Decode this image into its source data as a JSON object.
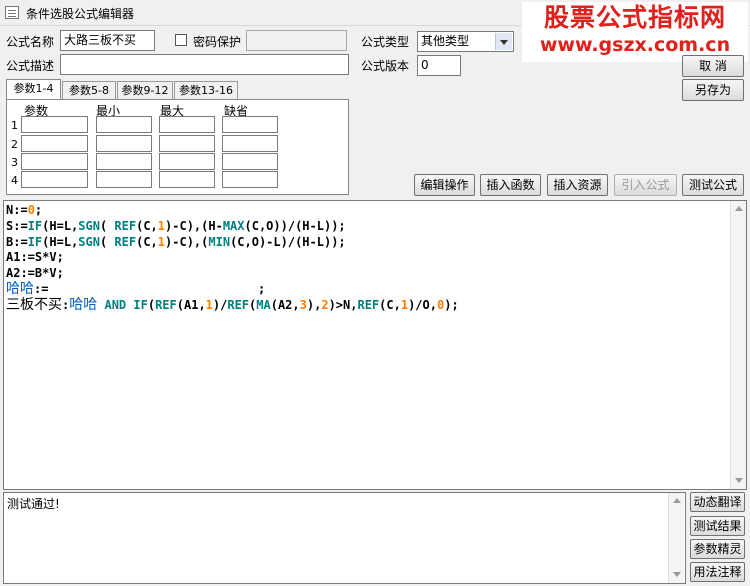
{
  "window": {
    "title": "条件选股公式编辑器"
  },
  "watermark": {
    "line1": "股票公式指标网",
    "line2": "www.gszx.com.cn"
  },
  "form": {
    "name_label": "公式名称",
    "name_value": "大路三板不买",
    "password_label": "密码保护",
    "password_checked": false,
    "type_label": "公式类型",
    "type_value": "其他类型",
    "desc_label": "公式描述",
    "desc_value": "",
    "version_label": "公式版本",
    "version_value": "0"
  },
  "right_buttons": {
    "cancel": "取  消",
    "save_as": "另存为"
  },
  "tabs": [
    {
      "label": "参数1-4",
      "active": true
    },
    {
      "label": "参数5-8",
      "active": false
    },
    {
      "label": "参数9-12",
      "active": false
    },
    {
      "label": "参数13-16",
      "active": false
    }
  ],
  "params": {
    "headers": [
      "参数",
      "最小",
      "最大",
      "缺省"
    ],
    "rows": [
      "1",
      "2",
      "3",
      "4"
    ]
  },
  "toolbar": {
    "edit_ops": "编辑操作",
    "insert_func": "插入函数",
    "insert_res": "插入资源",
    "import_formula": "引入公式",
    "test_formula": "测试公式"
  },
  "code_lines": [
    "N:=0;",
    "S:=IF(H=L,SGN( REF(C,1)-C),(H-MAX(C,O))/(H-L));",
    "B:=IF(H=L,SGN( REF(C,1)-C),(MIN(C,O)-L)/(H-L));",
    "A1:=S*V;",
    "A2:=B*V;",
    "哈哈:=                             ;",
    "三板不买:哈哈 AND IF(REF(A1,1)/REF(MA(A2,3),2)>N,REF(C,1)/O,0);"
  ],
  "output": {
    "text": "测试通过!"
  },
  "side_buttons": {
    "dynamic_translate": "动态翻译",
    "test_result": "测试结果",
    "param_wizard": "参数精灵",
    "usage_notes": "用法注释"
  }
}
